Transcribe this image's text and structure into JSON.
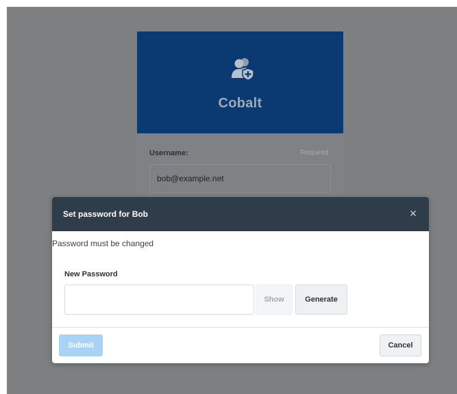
{
  "app": {
    "brand_name": "Cobalt",
    "brand_icon": "users-shield-icon"
  },
  "login_form": {
    "username_label": "Username:",
    "username_required": "Required",
    "username_value": "bob@example.net"
  },
  "dialog": {
    "title": "Set password for Bob",
    "close_icon": "close-icon",
    "close_glyph": "✕",
    "message": "Password must be changed",
    "new_password_label": "New Password",
    "new_password_value": "",
    "show_label": "Show",
    "generate_label": "Generate",
    "submit_label": "Submit",
    "cancel_label": "Cancel"
  },
  "colors": {
    "brand_header": "#0b3a73",
    "dialog_header": "#2f3d4b",
    "submit_disabled": "#a9d3f5",
    "backdrop": "#7d7f81"
  }
}
